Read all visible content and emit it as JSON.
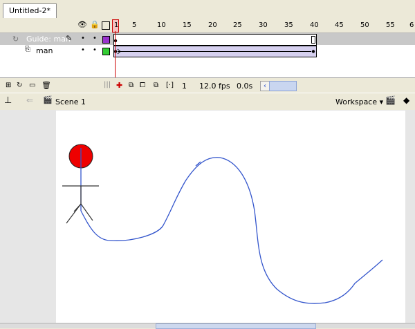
{
  "document": {
    "tab_title": "Untitled-2*"
  },
  "timeline": {
    "header_icons": [
      "eye-icon",
      "lock-icon",
      "outline-square-icon"
    ],
    "frame_numbers": [
      "1",
      "5",
      "10",
      "15",
      "20",
      "25",
      "30",
      "35",
      "40",
      "45",
      "50",
      "55",
      "6"
    ],
    "layers": [
      {
        "name": "Guide: man",
        "visible_dot": "•",
        "lock_dot": "•",
        "outline_color": "#9933cc",
        "pencil": true
      },
      {
        "name": "man",
        "visible_dot": "•",
        "lock_dot": "•",
        "outline_color": "#33cc33",
        "pencil": false
      }
    ],
    "footer": {
      "current_frame": "1",
      "frame_rate": "12.0 fps",
      "elapsed_time": "0.0s"
    }
  },
  "scene_bar": {
    "scene_name": "Scene 1",
    "workspace_label": "Workspace ▾"
  },
  "colors": {
    "playhead": "#cc0000",
    "head_fill": "#ee0000",
    "guide_path": "#3355cc",
    "stick_figure": "#333333"
  }
}
